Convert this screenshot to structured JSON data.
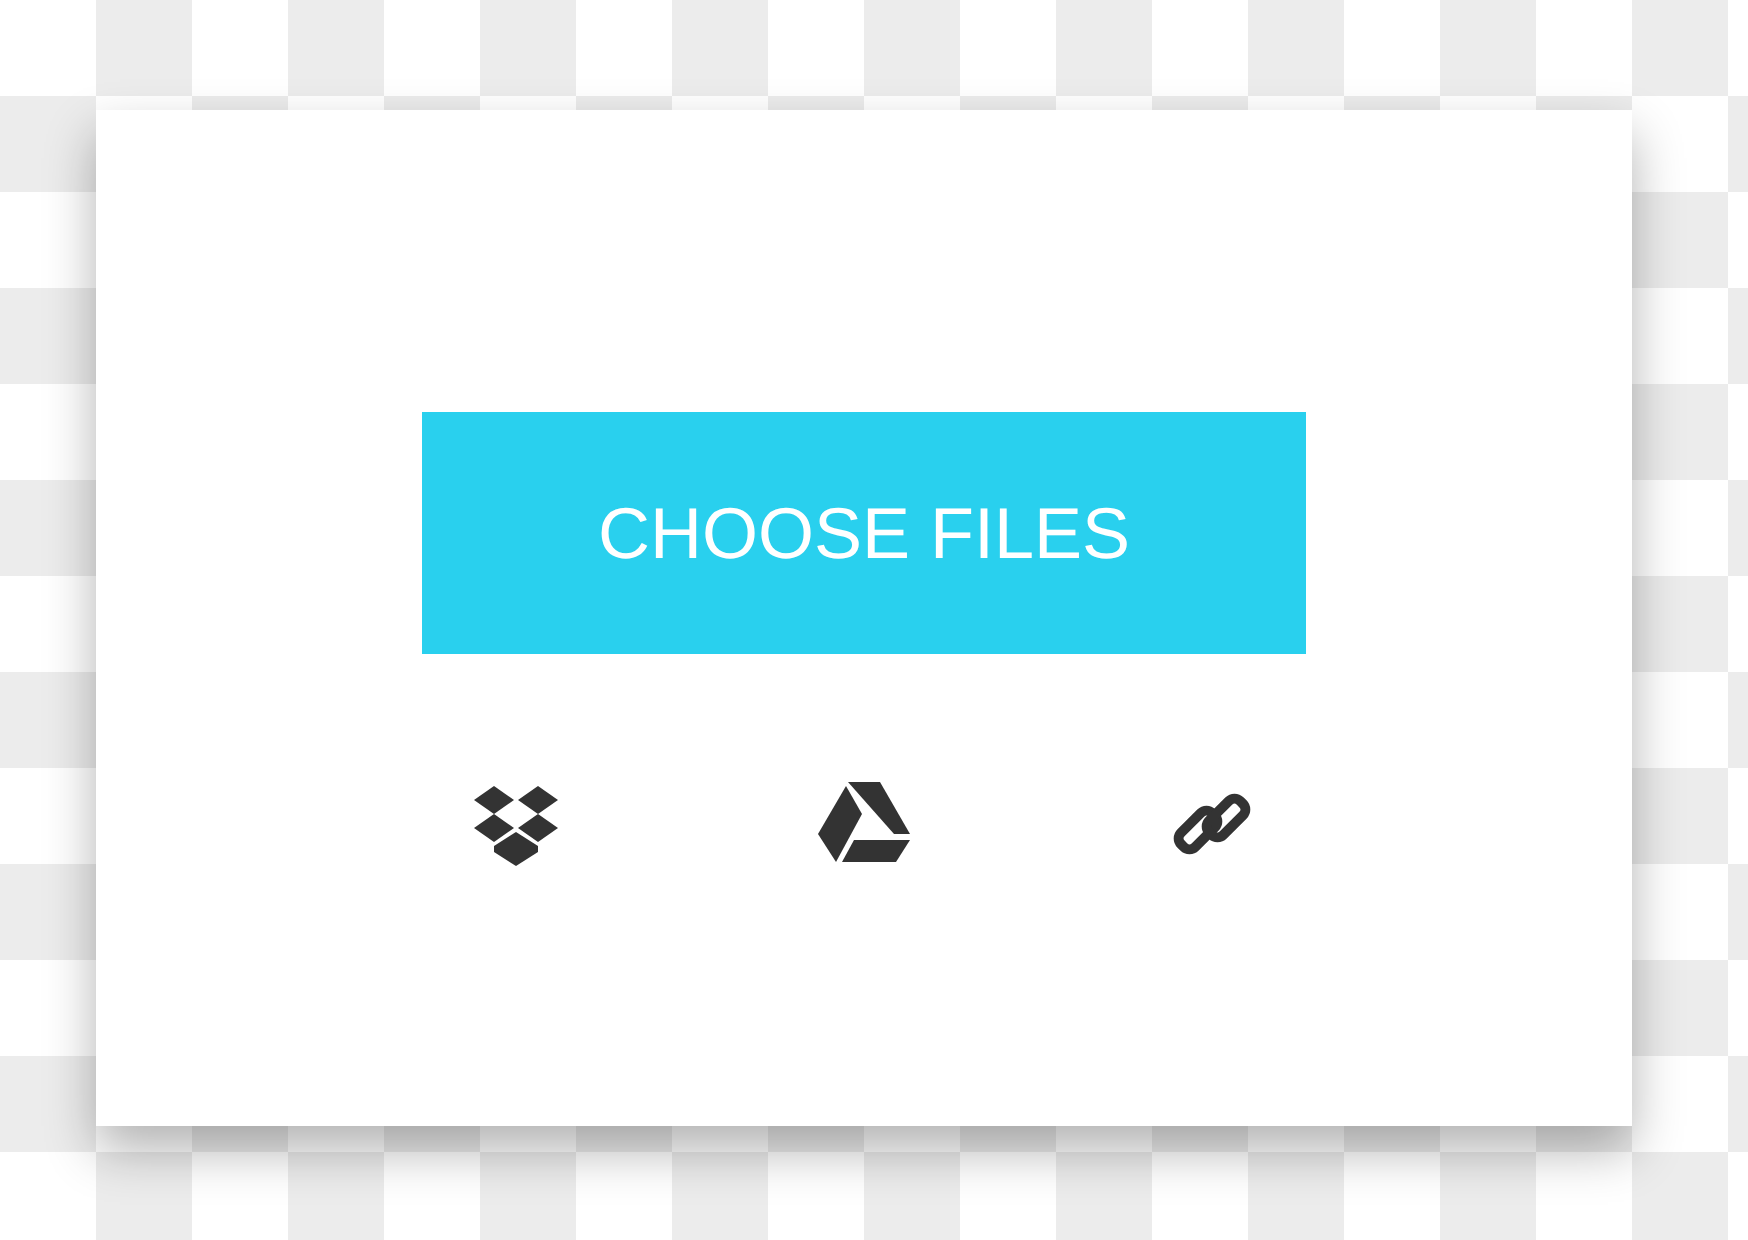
{
  "button": {
    "label": "CHOOSE FILES"
  }
}
